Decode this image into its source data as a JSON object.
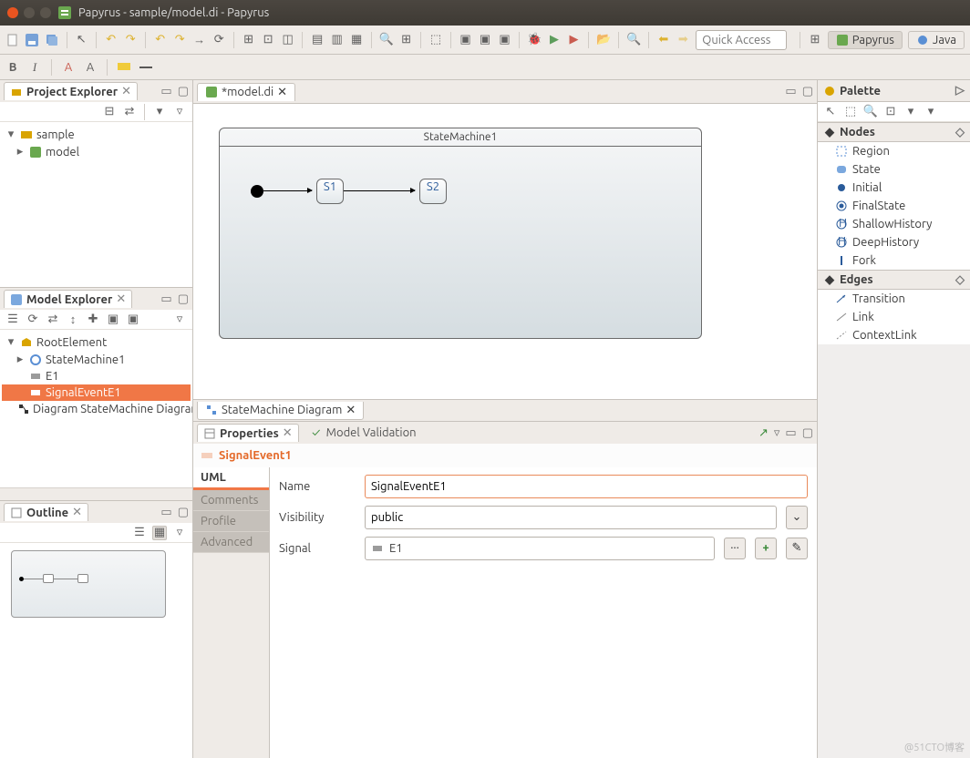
{
  "window": {
    "title": "Papyrus - sample/model.di - Papyrus"
  },
  "quick_access": {
    "placeholder": "Quick Access"
  },
  "perspectives": {
    "papyrus": "Papyrus",
    "java": "Java"
  },
  "formatting": {
    "bold": "B",
    "italic": "I",
    "fontA": "A",
    "fontA2": "A"
  },
  "project_explorer": {
    "title": "Project Explorer",
    "items": [
      {
        "label": "sample",
        "children": [
          {
            "label": "model"
          }
        ]
      }
    ]
  },
  "model_explorer": {
    "title": "Model Explorer",
    "root": "RootElement",
    "children": [
      {
        "label": "StateMachine1"
      },
      {
        "label": "E1"
      },
      {
        "label": "SignalEventE1",
        "selected": true
      },
      {
        "label": "Diagram StateMachine Diagram"
      }
    ]
  },
  "outline": {
    "title": "Outline"
  },
  "editor": {
    "tab": "*model.di",
    "state_machine": {
      "title": "StateMachine1",
      "states": [
        "S1",
        "S2"
      ]
    },
    "bottom_tab": "StateMachine Diagram"
  },
  "properties": {
    "tabs": {
      "properties": "Properties",
      "validation": "Model Validation"
    },
    "heading": "SignalEvent1",
    "categories": [
      "UML",
      "Comments",
      "Profile",
      "Advanced"
    ],
    "form": {
      "name_label": "Name",
      "name_value": "SignalEventE1",
      "visibility_label": "Visibility",
      "visibility_value": "public",
      "signal_label": "Signal",
      "signal_value": "E1"
    }
  },
  "palette": {
    "title": "Palette",
    "sections": {
      "nodes": {
        "title": "Nodes",
        "items": [
          "Region",
          "State",
          "Initial",
          "FinalState",
          "ShallowHistory",
          "DeepHistory",
          "Fork"
        ]
      },
      "edges": {
        "title": "Edges",
        "items": [
          "Transition",
          "Link",
          "ContextLink"
        ]
      }
    }
  },
  "watermark": "@51CTO博客"
}
